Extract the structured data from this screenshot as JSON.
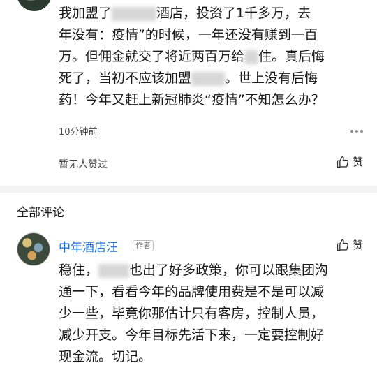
{
  "first_comment": {
    "lines": [
      "我加盟了",
      "酒店，投资了1千多万，去",
      "年没有：疫情”的时候，一年还没有赚到一百",
      "万。但佣金就交了将近两百万给",
      "住。真后悔",
      "死了，当初不应该加盟",
      "。世上没有后悔",
      "药！今年又赶上新冠肺炎“疫情”不知怎么办？"
    ],
    "time": "10分钟前",
    "no_likes_text": "暂无人赞过",
    "like_label": "赞"
  },
  "section": {
    "title": "全部评论"
  },
  "reply": {
    "name": "中年酒店汪",
    "badge": "作者",
    "like_label": "赞",
    "lines": [
      "稳住，",
      "也出了好多政策，你可以跟集团沟",
      "通一下，看看今年的品牌使用费是不是可以减",
      "少一些，毕竟你那估计只有客房，控制人员，",
      "减少开支。今年目标先活下来，一定要控制好",
      "现金流。切记。"
    ]
  },
  "colors": {
    "link": "#1e6fd9",
    "divider": "#f4f4f4",
    "muted": "#444444"
  },
  "icons": [
    "thumbs-up-icon",
    "more-dots-icon"
  ]
}
